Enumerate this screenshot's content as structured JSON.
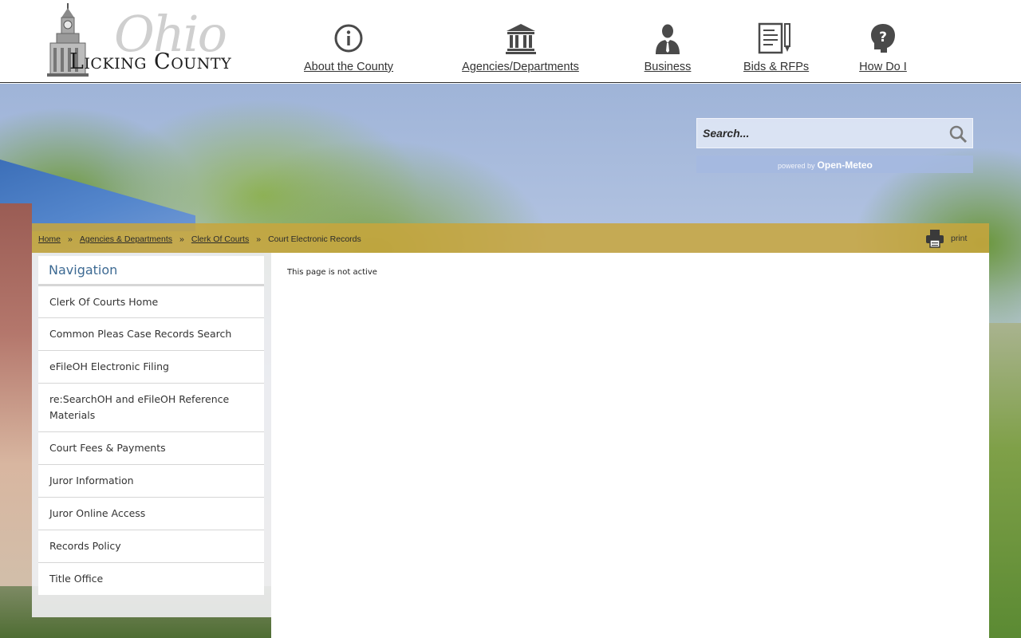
{
  "header": {
    "logo": {
      "ohio": "Ohio",
      "name": "Licking County"
    },
    "nav": [
      {
        "label": "About the County",
        "icon": "info-icon"
      },
      {
        "label": "Agencies/Departments",
        "icon": "government-building-icon"
      },
      {
        "label": "Business",
        "icon": "businessman-icon"
      },
      {
        "label": "Bids & RFPs",
        "icon": "document-pen-icon"
      },
      {
        "label": "How Do I",
        "icon": "question-head-icon"
      }
    ]
  },
  "search": {
    "placeholder": "Search...",
    "powered_prefix": "powered by",
    "powered_brand": "Open-Meteo"
  },
  "breadcrumb": {
    "items": [
      "Home",
      "Agencies & Departments",
      "Clerk Of Courts"
    ],
    "current": "Court Electronic Records",
    "separator": "»",
    "print_label": "print"
  },
  "sidebar": {
    "title": "Navigation",
    "items": [
      "Clerk Of Courts Home",
      "Common Pleas Case Records Search",
      "eFileOH Electronic Filing",
      "re:SearchOH and eFileOH Reference Materials",
      "Court Fees & Payments",
      "Juror Information",
      "Juror Online Access",
      "Records Policy",
      "Title Office"
    ]
  },
  "content": {
    "message": "This page is not active"
  },
  "colors": {
    "breadcrumb_bar": "#c8a53c",
    "sidebar_title": "#3d6a93",
    "icon": "#4a4a4a"
  }
}
